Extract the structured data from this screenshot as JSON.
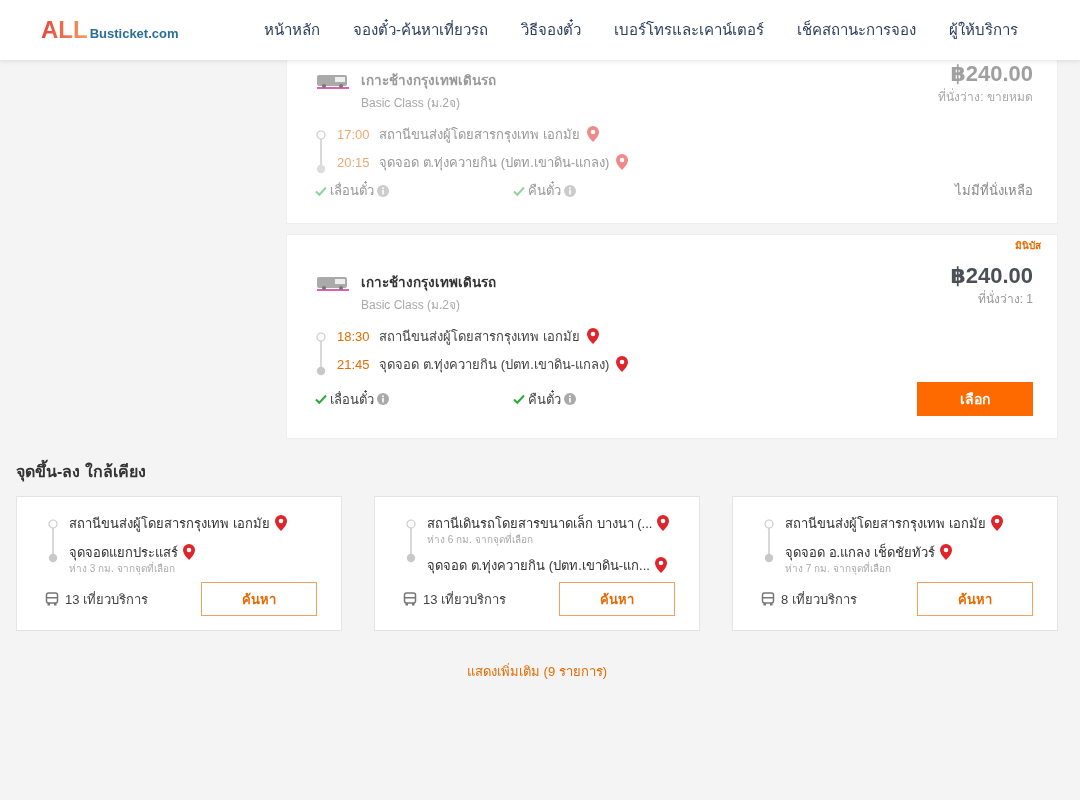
{
  "header": {
    "logo": {
      "main": "ALL",
      "sub": "Busticket.com"
    },
    "nav": [
      {
        "label": "หน้าหลัก"
      },
      {
        "label": "จองตั๋ว-ค้นหาเที่ยวรถ"
      },
      {
        "label": "วิธีจองตั๋ว"
      },
      {
        "label": "เบอร์โทรและเคาน์เตอร์"
      },
      {
        "label": "เช็คสถานะการจอง"
      },
      {
        "label": "ผู้ให้บริการ"
      }
    ]
  },
  "trips": [
    {
      "available": false,
      "operator": "เกาะช้างกรุงเทพเดินรถ",
      "bus_class": "Basic Class (ม.2จ)",
      "price": "฿240.00",
      "seats": "ที่นั่งว่าง: ขายหมด",
      "stops": [
        {
          "time": "17:00",
          "place": "สถานีขนส่งผู้โดยสารกรุงเทพ เอกมัย"
        },
        {
          "time": "20:15",
          "place": "จุดจอด ต.ทุ่งควายกิน (ปตท.เขาดิน-แกลง)"
        }
      ],
      "features": [
        {
          "label": "เลื่อนตั๋ว"
        },
        {
          "label": "คืนตั๋ว"
        }
      ],
      "status": "ไม่มีที่นั่งเหลือ"
    },
    {
      "available": true,
      "badge": "มินิบัส",
      "operator": "เกาะช้างกรุงเทพเดินรถ",
      "bus_class": "Basic Class (ม.2จ)",
      "price": "฿240.00",
      "seats": "ที่นั่งว่าง: 1",
      "stops": [
        {
          "time": "18:30",
          "place": "สถานีขนส่งผู้โดยสารกรุงเทพ เอกมัย"
        },
        {
          "time": "21:45",
          "place": "จุดจอด ต.ทุ่งควายกิน (ปตท.เขาดิน-แกลง)"
        }
      ],
      "features": [
        {
          "label": "เลื่อนตั๋ว"
        },
        {
          "label": "คืนตั๋ว"
        }
      ],
      "button": "เลือก"
    }
  ],
  "nearby": {
    "title": "จุดขึ้น-ลง ใกล้เคียง",
    "routes": [
      {
        "stops": [
          {
            "place": "สถานีขนส่งผู้โดยสารกรุงเทพ เอกมัย"
          },
          {
            "place": "จุดจอดแยกประแสร์",
            "distance": "ห่าง 3 กม. จากจุดที่เลือก"
          }
        ],
        "trips": "13 เที่ยวบริการ",
        "button": "ค้นหา"
      },
      {
        "stops": [
          {
            "place": "สถานีเดินรถโดยสารขนาดเล็ก บางนา (...",
            "distance": "ห่าง 6 กม. จากจุดที่เลือก"
          },
          {
            "place": "จุดจอด ต.ทุ่งควายกิน (ปตท.เขาดิน-แก..."
          }
        ],
        "trips": "13 เที่ยวบริการ",
        "button": "ค้นหา"
      },
      {
        "stops": [
          {
            "place": "สถานีขนส่งผู้โดยสารกรุงเทพ เอกมัย"
          },
          {
            "place": "จุดจอด อ.แกลง เช็ดชัยทัวร์",
            "distance": "ห่าง 7 กม. จากจุดที่เลือก"
          }
        ],
        "trips": "8 เที่ยวบริการ",
        "button": "ค้นหา"
      }
    ],
    "more": "แสดงเพิ่มเติม (9 รายการ)"
  }
}
